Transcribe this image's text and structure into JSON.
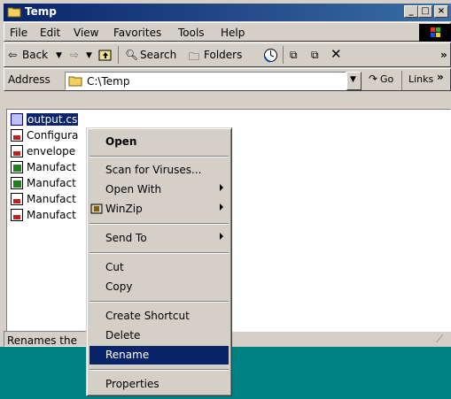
{
  "window": {
    "title": "Temp"
  },
  "menubar": {
    "items": [
      "File",
      "Edit",
      "View",
      "Favorites",
      "Tools",
      "Help"
    ]
  },
  "toolbar": {
    "back_label": "Back",
    "search_label": "Search",
    "folders_label": "Folders",
    "overflow": "»"
  },
  "address": {
    "label": "Address",
    "value": "C:\\Temp",
    "go_label": "Go",
    "links_label": "Links",
    "links_overflow": "»"
  },
  "files": [
    {
      "name": "output.cs",
      "icon": "cs-file-icon",
      "selected": true
    },
    {
      "name": "Configura",
      "icon": "document-icon"
    },
    {
      "name": "envelope",
      "icon": "document-icon"
    },
    {
      "name": "Manufact",
      "icon": "app-icon"
    },
    {
      "name": "Manufact",
      "icon": "app-icon"
    },
    {
      "name": "Manufact",
      "icon": "document-icon"
    },
    {
      "name": "Manufact",
      "icon": "document-icon"
    }
  ],
  "status": {
    "text": "Renames the"
  },
  "context_menu": {
    "open": "Open",
    "scan": "Scan for Viruses...",
    "open_with": "Open With",
    "winzip": "WinZip",
    "send_to": "Send To",
    "cut": "Cut",
    "copy": "Copy",
    "create_shortcut": "Create Shortcut",
    "delete": "Delete",
    "rename": "Rename",
    "properties": "Properties"
  },
  "colors": {
    "titlebar": "#0a246a",
    "desktop": "#008080",
    "highlight": "#0a246a",
    "face": "#d4d0c8"
  }
}
